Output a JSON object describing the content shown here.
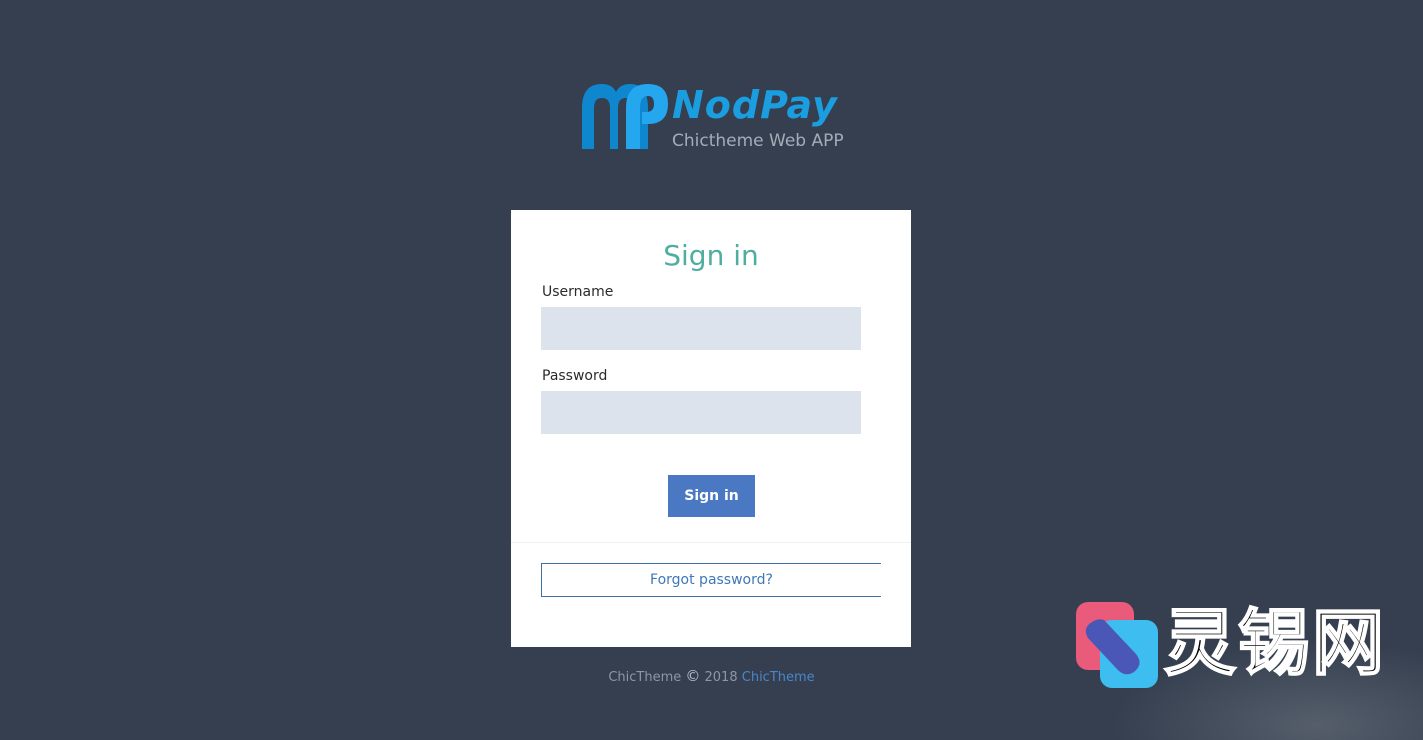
{
  "brand": {
    "name": "NodPay",
    "tagline": "Chictheme Web APP",
    "color": "#1a9ee0"
  },
  "signin": {
    "title": "Sign in",
    "username_label": "Username",
    "username_value": "",
    "password_label": "Password",
    "password_value": "",
    "submit_label": "Sign in",
    "forgot_label": "Forgot password?"
  },
  "footer": {
    "prefix": "ChicTheme",
    "year": "2018",
    "link": "ChicTheme"
  },
  "watermark": {
    "text": "灵锡网"
  },
  "colors": {
    "background": "#353f4f",
    "title": "#4eaea0",
    "button": "#4a78c2",
    "input": "#dde3ec",
    "link": "#4a86c9"
  }
}
